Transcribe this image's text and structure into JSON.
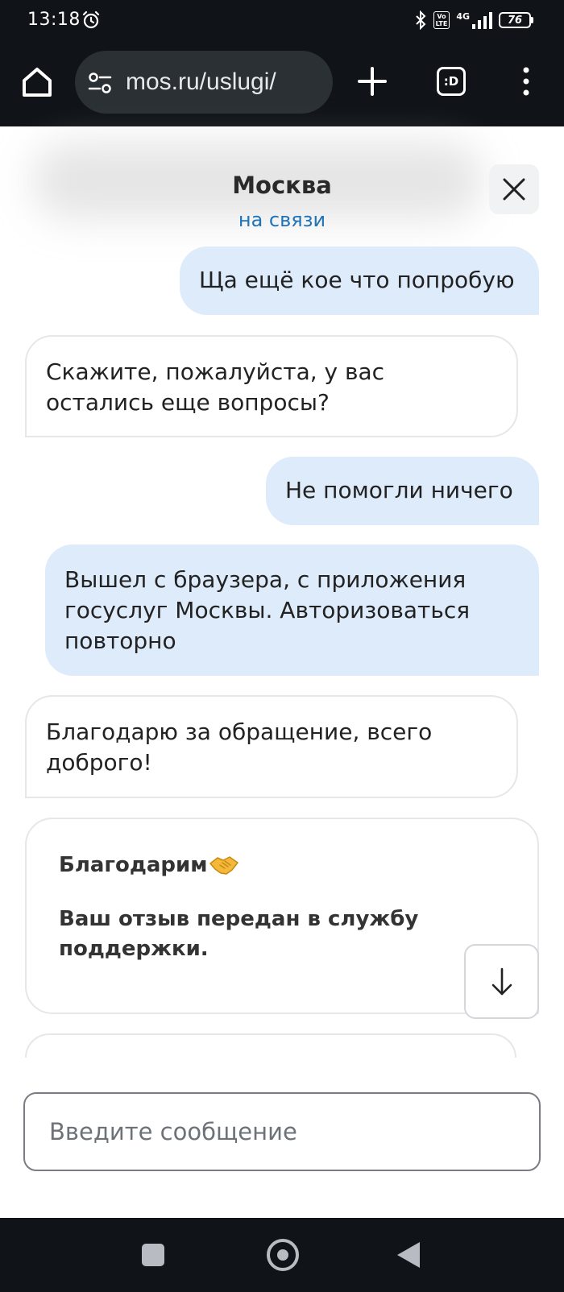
{
  "status_bar": {
    "time": "13:18",
    "volte_top": "Vo",
    "volte_bottom": "LTE",
    "network": "4G",
    "battery": "76"
  },
  "browser": {
    "url": "mos.ru/uslugi/",
    "tabs_label": ":D"
  },
  "chat": {
    "title": "Москва",
    "status": "на связи"
  },
  "messages": [
    {
      "from": "user",
      "lines": [
        "Ща ещё кое что попробую"
      ]
    },
    {
      "from": "operator",
      "lines": [
        "Скажите, пожалуйста, у вас",
        "остались еще вопросы?"
      ]
    },
    {
      "from": "user",
      "lines": [
        "Не помогли ничего"
      ]
    },
    {
      "from": "user",
      "lines": [
        "Вышел с браузера, с приложения",
        "госуслуг Москвы. Авторизоваться",
        "повторно"
      ]
    },
    {
      "from": "operator",
      "lines": [
        "Благодарю за обращение, всего",
        "доброго!"
      ]
    }
  ],
  "feedback": {
    "title": "Благодарим",
    "text": "Ваш отзыв передан в службу поддержки."
  },
  "composer": {
    "placeholder": "Введите сообщение"
  },
  "colors": {
    "bar_bg": "#101418",
    "link_blue": "#1f73b7",
    "outgoing_bubble": "#deebfb"
  }
}
